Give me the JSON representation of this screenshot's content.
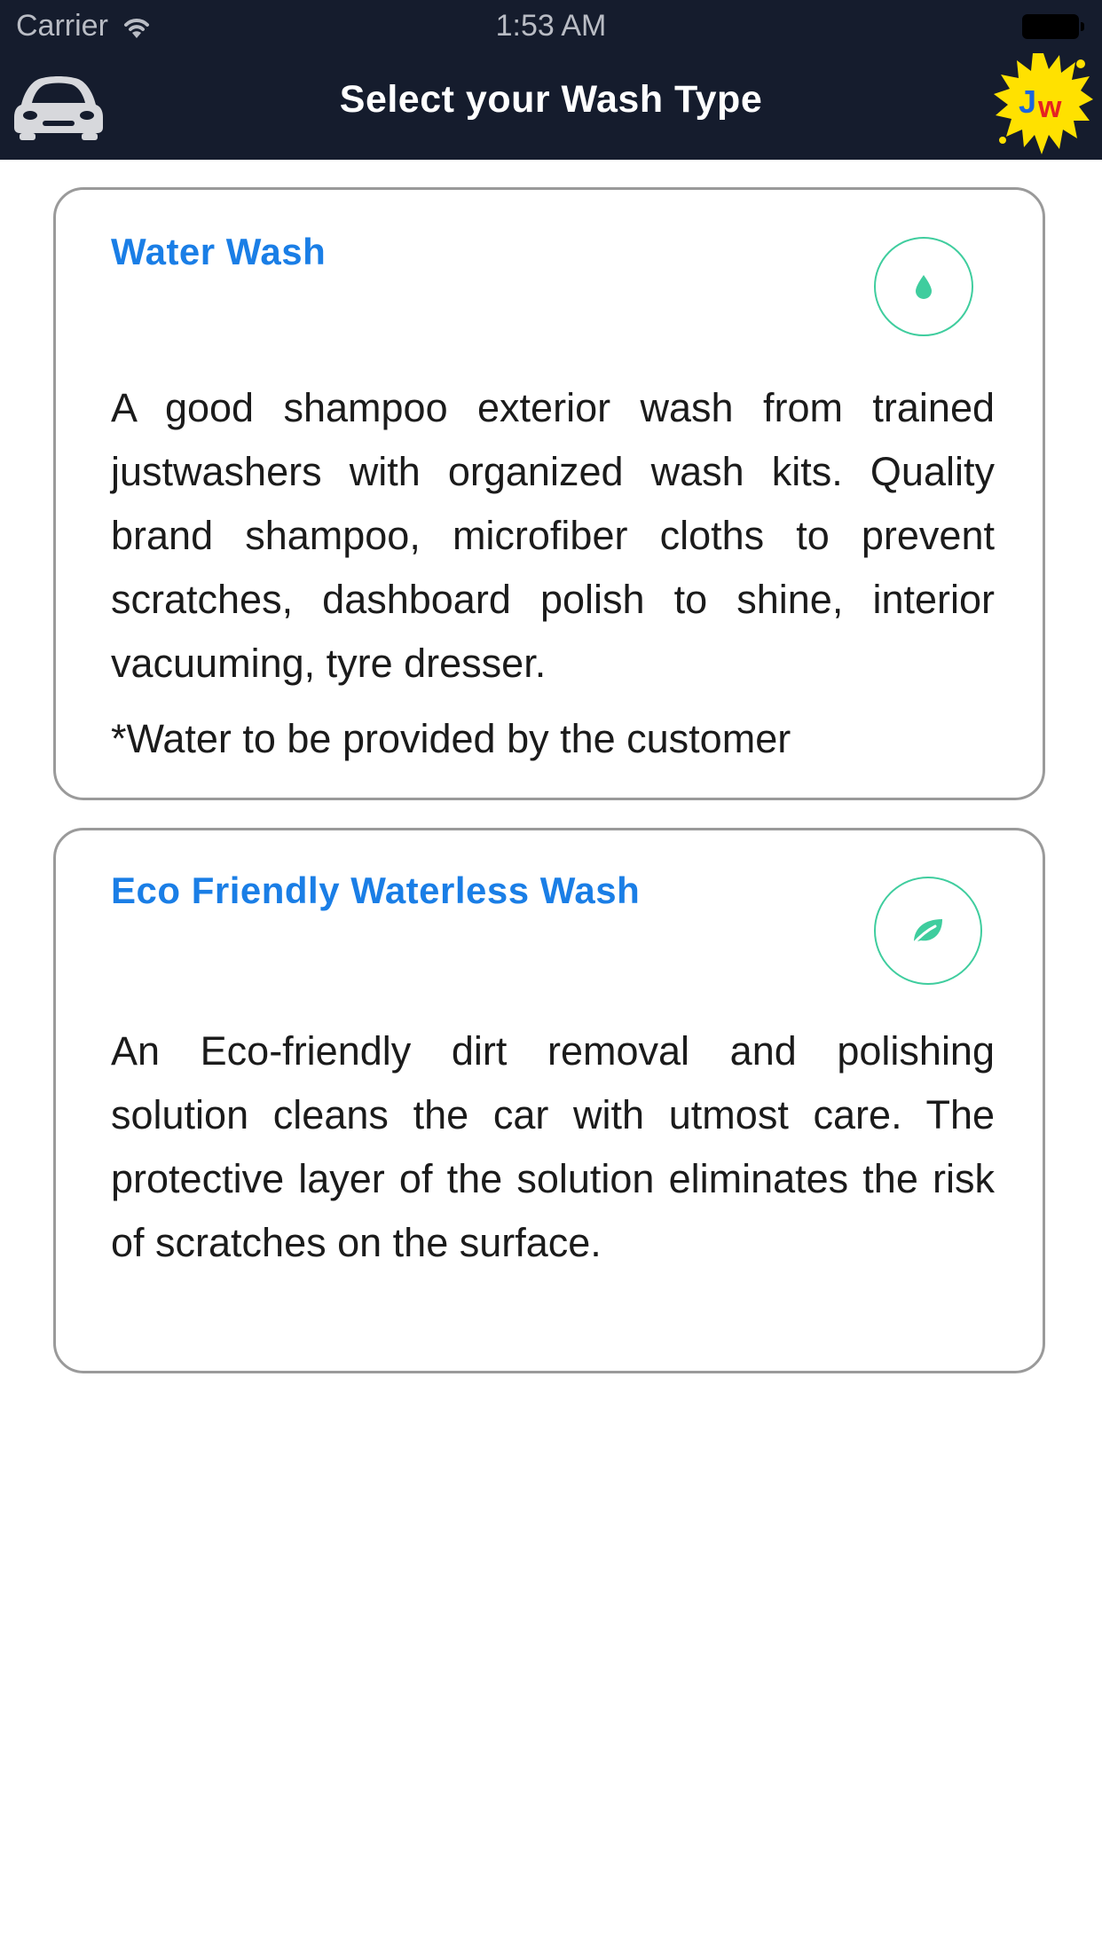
{
  "status_bar": {
    "carrier": "Carrier",
    "time": "1:53 AM"
  },
  "header": {
    "title": "Select your Wash Type",
    "background_color": "#151c2d",
    "left_icon": "car-icon",
    "right_logo": "jw-logo",
    "logo_text": "Jw"
  },
  "wash_types": [
    {
      "title": "Water Wash",
      "icon": "water-drop-icon",
      "description": "A good shampoo exterior wash from trained justwashers with organized wash kits. Quality brand shampoo, microfiber cloths to prevent scratches, dashboard polish to shine, interior vacuuming, tyre dresser.",
      "note": "*Water to be provided by the customer"
    },
    {
      "title": "Eco Friendly Waterless Wash",
      "icon": "leaf-icon",
      "description": "An Eco-friendly dirt removal and polishing solution cleans the car with utmost care. The protective layer of the solution eliminates the risk of scratches on the surface."
    }
  ],
  "colors": {
    "title_blue": "#1a7ee6",
    "icon_green": "#3fcd9e",
    "card_border": "#9a9a9a"
  }
}
